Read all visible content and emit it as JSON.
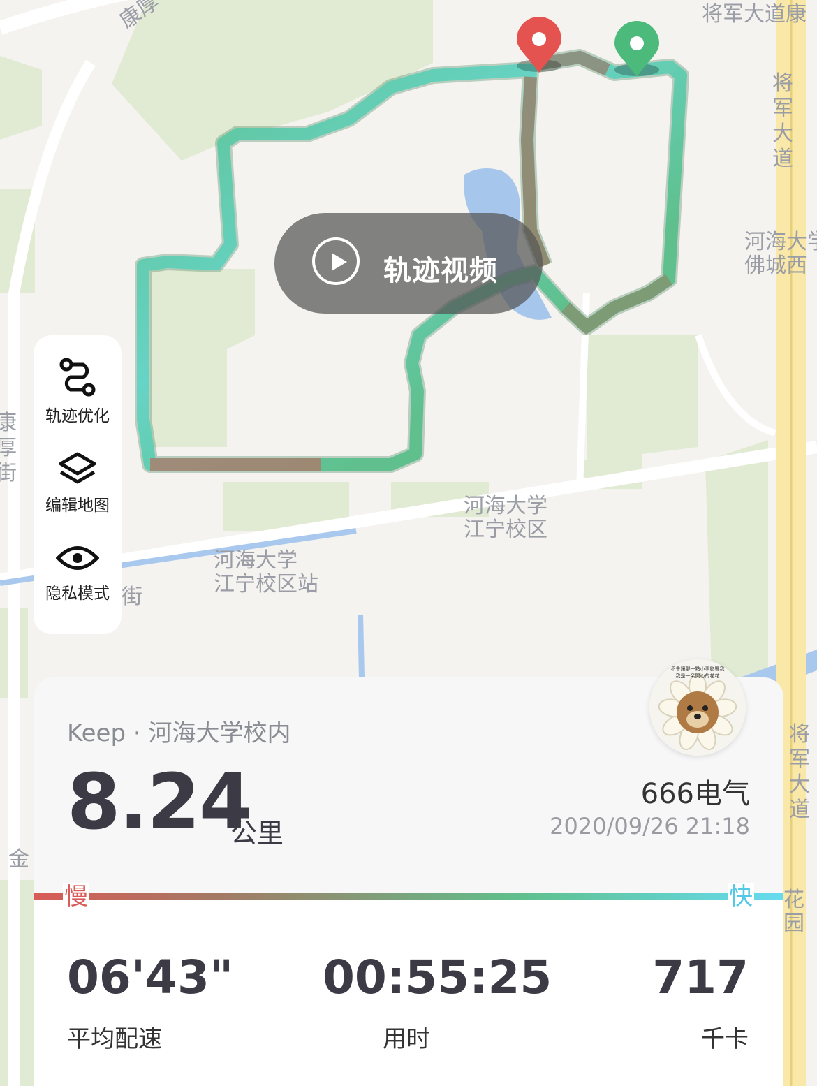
{
  "map": {
    "labels": {
      "kanghou_top": "康厚",
      "jiangjun_top": "将军大道康",
      "jiangjun_vert1": "将军大道",
      "hohai_foc": "河海大学\n佛城西",
      "kanghou_left": "康厚街",
      "campus": "河海大学\n江宁校区",
      "station": "河海大学\n江宁校区站",
      "jie": "街",
      "jin": "金",
      "jiangjun_vert2": "将军大道",
      "huayuan": "花园"
    },
    "play_button": "轨迹视频"
  },
  "tools": [
    {
      "label": "轨迹优化",
      "icon": "route-icon"
    },
    {
      "label": "编辑地图",
      "icon": "layers-icon"
    },
    {
      "label": "隐私模式",
      "icon": "eye-icon"
    }
  ],
  "summary": {
    "source": "Keep · 河海大学校内",
    "distance": "8.24",
    "unit": "公里",
    "username": "666电气",
    "datetime": "2020/09/26 21:18",
    "avatar_caption": "不會讓那一點小事影響我 我是一朵開心的花花"
  },
  "pace_legend": {
    "slow": "慢",
    "fast": "快",
    "colors": [
      "#d95b57",
      "#5fc08d",
      "#66dbf0"
    ]
  },
  "stats": [
    {
      "value": "06'43\"",
      "label": "平均配速"
    },
    {
      "value": "00:55:25",
      "label": "用时"
    },
    {
      "value": "717",
      "label": "千卡"
    }
  ]
}
